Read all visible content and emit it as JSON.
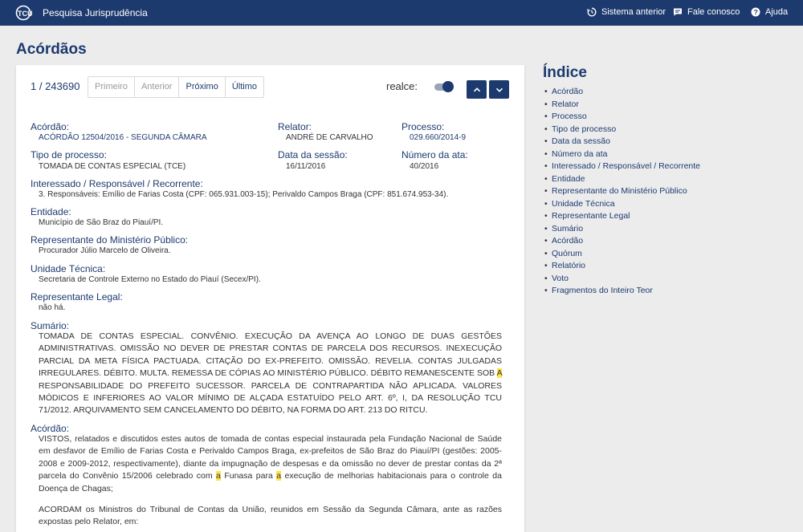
{
  "header": {
    "app_title": "Pesquisa Jurisprudência",
    "nav": [
      {
        "label": "Sistema anterior",
        "icon": "history-icon"
      },
      {
        "label": "Fale conosco",
        "icon": "chat-icon"
      },
      {
        "label": "Ajuda",
        "icon": "help-icon"
      }
    ],
    "brand_color": "#1d3a6e"
  },
  "page": {
    "title": "Acórdãos"
  },
  "pager": {
    "count": "1 / 243690",
    "first": "Primeiro",
    "prev": "Anterior",
    "next": "Próximo",
    "last": "Último"
  },
  "realce": {
    "label": "realce:",
    "enabled": true
  },
  "fields": {
    "acordao": {
      "label": "Acórdão:",
      "value": "ACÓRDÃO 12504/2016 - SEGUNDA CÂMARA"
    },
    "relator": {
      "label": "Relator:",
      "value": "ANDRÉ DE CARVALHO"
    },
    "processo": {
      "label": "Processo:",
      "value": "029.660/2014-9"
    },
    "tipo_processo": {
      "label": "Tipo de processo:",
      "value": "TOMADA DE CONTAS ESPECIAL (TCE)"
    },
    "data_sessao": {
      "label": "Data da sessão:",
      "value": "16/11/2016"
    },
    "numero_ata": {
      "label": "Número da ata:",
      "value": "40/2016"
    },
    "interessado": {
      "label": "Interessado / Responsável / Recorrente:",
      "value": "3. Responsáveis: Emílio de Farias Costa (CPF: 065.931.003-15); Perivaldo Campos Braga (CPF: 851.674.953-34)."
    },
    "entidade": {
      "label": "Entidade:",
      "value": "Município de São Braz do Piauí/PI."
    },
    "representante_mp": {
      "label": "Representante do Ministério Público:",
      "value": "Procurador Júlio Marcelo de Oliveira."
    },
    "unidade_tecnica": {
      "label": "Unidade Técnica:",
      "value": "Secretaria de Controle Externo no Estado do Piauí (Secex/PI)."
    },
    "representante_legal": {
      "label": "Representante Legal:",
      "value": "não há."
    },
    "sumario": {
      "label": "Sumário:",
      "part1": "TOMADA DE CONTAS ESPECIAL. CONVÊNIO. EXECUÇÃO DA AVENÇA AO LONGO DE DUAS GESTÕES ADMINISTRATIVAS. OMISSÃO NO DEVER DE PRESTAR CONTAS DE PARCELA DOS RECURSOS. INEXECUÇÃO PARCIAL DA META FÍSICA PACTUADA. CITAÇÃO DO EX-PREFEITO. OMISSÃO. REVELIA. CONTAS JULGADAS IRREGULARES. DÉBITO. MULTA. REMESSA DE CÓPIAS AO MINISTÉRIO PÚBLICO. DÉBITO REMANESCENTE SOB ",
      "hl1": "A",
      "part2": " RESPONSABILIDADE DO PREFEITO SUCESSOR. PARCELA DE CONTRAPARTIDA NÃO APLICADA. VALORES MÓDICOS E INFERIORES AO VALOR MÍNIMO DE ALÇADA ESTATUÍDO PELO ART. 6º, I, DA RESOLUÇÃO TCU 71/2012. ARQUIVAMENTO SEM CANCELAMENTO DO DÉBITO, NA FORMA DO ART. 213 DO RITCU."
    },
    "acordao_text": {
      "label": "Acórdão:",
      "p1_part1": "VISTOS, relatados e discutidos estes autos de tomada de contas especial instaurada pela Fundação Nacional de Saúde em desfavor de Emílio de Farias Costa e Perivaldo Campos Braga, ex-prefeitos de São Braz do Piauí/PI (gestões: 2005-2008 e 2009-2012, respectivamente), diante da impugnação de despesas e da omissão no dever de prestar contas da 2ª parcela do Convênio 15/2006 celebrado com ",
      "p1_hl1": "a",
      "p1_part2": " Funasa para ",
      "p1_hl2": "a",
      "p1_part3": " execução de melhorias habitacionais para o controle da Doença de Chagas;",
      "p2": "ACORDAM os Ministros do Tribunal de Contas da União, reunidos em Sessão da Segunda Câmara, ante as razões expostas pelo Relator, em:"
    }
  },
  "index": {
    "title": "Índice",
    "items": [
      "Acórdão",
      "Relator",
      "Processo",
      "Tipo de processo",
      "Data da sessão",
      "Número da ata",
      "Interessado / Responsável / Recorrente",
      "Entidade",
      "Representante do Ministério Público",
      "Unidade Técnica",
      "Representante Legal",
      "Sumário",
      "Acórdão",
      "Quórum",
      "Relatório",
      "Voto",
      "Fragmentos do Inteiro Teor"
    ]
  }
}
